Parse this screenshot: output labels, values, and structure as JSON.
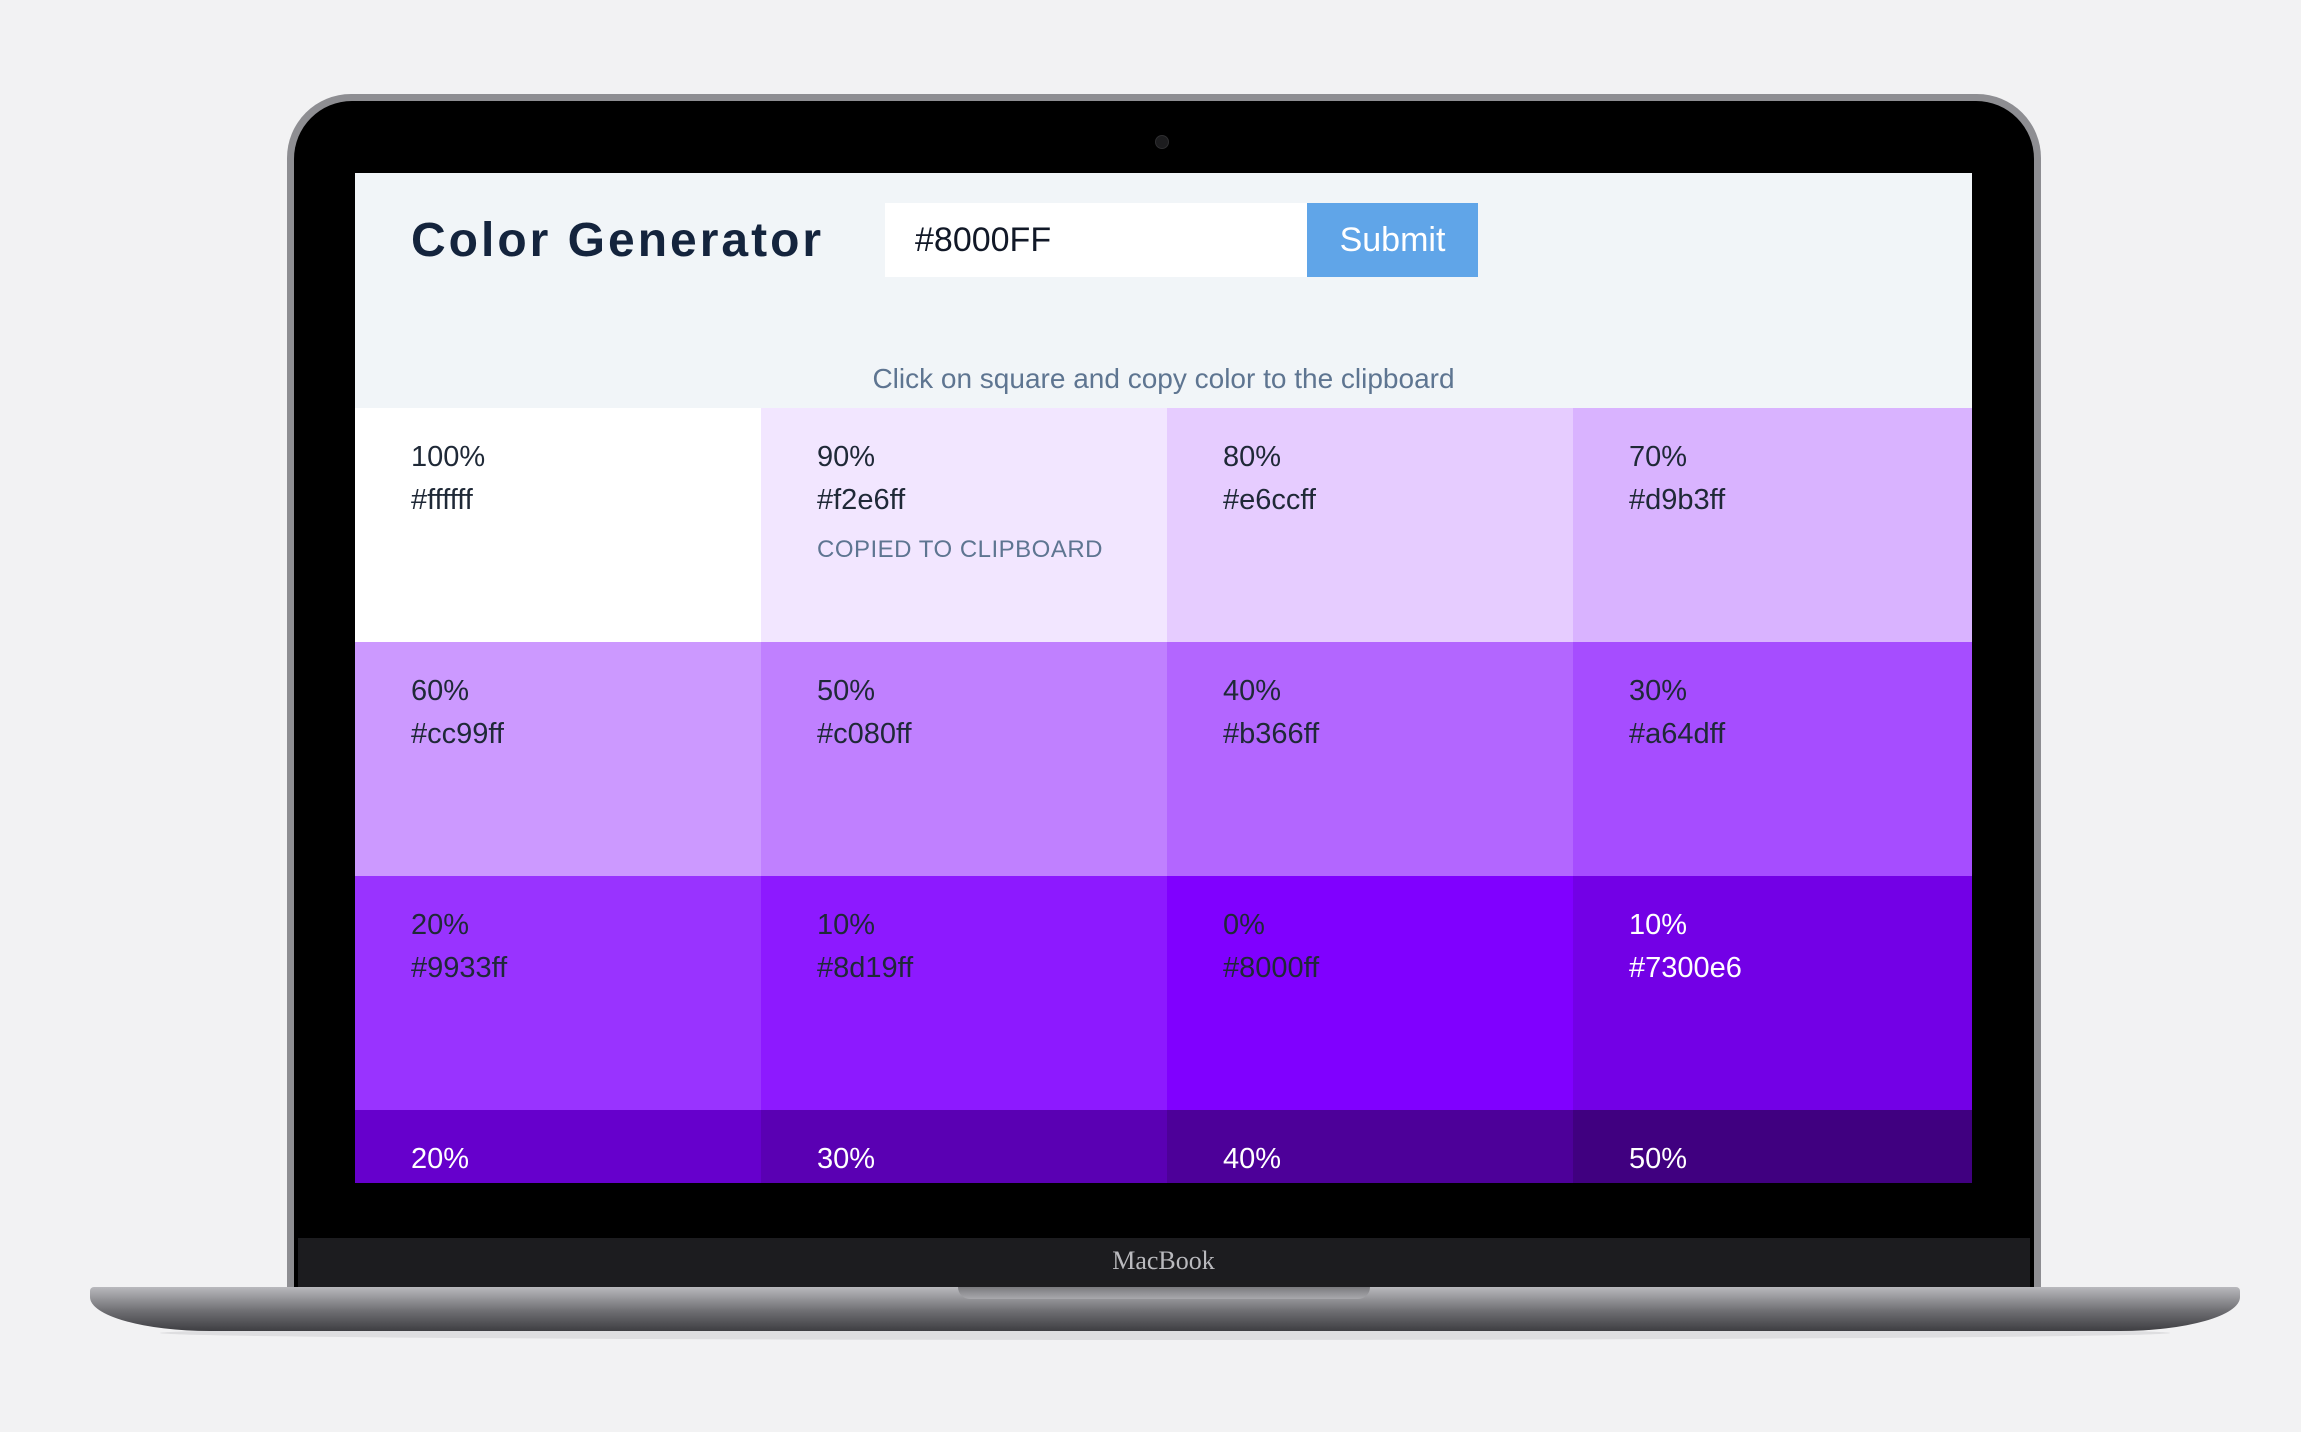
{
  "device": {
    "brand": "MacBook"
  },
  "app": {
    "title": "Color Generator",
    "input_value": "#8000FF",
    "submit_label": "Submit",
    "instructions": "Click on square and copy color to the clipboard",
    "copied_label": "COPIED TO CLIPBOARD"
  },
  "swatches": [
    {
      "percent": "100%",
      "hex": "#ffffff",
      "color": "#ffffff",
      "text": "dark",
      "copied": false
    },
    {
      "percent": "90%",
      "hex": "#f2e6ff",
      "color": "#f2e6ff",
      "text": "dark",
      "copied": true
    },
    {
      "percent": "80%",
      "hex": "#e6ccff",
      "color": "#e6ccff",
      "text": "dark",
      "copied": false
    },
    {
      "percent": "70%",
      "hex": "#d9b3ff",
      "color": "#d9b3ff",
      "text": "dark",
      "copied": false
    },
    {
      "percent": "60%",
      "hex": "#cc99ff",
      "color": "#cc99ff",
      "text": "dark",
      "copied": false
    },
    {
      "percent": "50%",
      "hex": "#c080ff",
      "color": "#c080ff",
      "text": "dark",
      "copied": false
    },
    {
      "percent": "40%",
      "hex": "#b366ff",
      "color": "#b366ff",
      "text": "dark",
      "copied": false
    },
    {
      "percent": "30%",
      "hex": "#a64dff",
      "color": "#a64dff",
      "text": "dark",
      "copied": false
    },
    {
      "percent": "20%",
      "hex": "#9933ff",
      "color": "#9933ff",
      "text": "dark",
      "copied": false
    },
    {
      "percent": "10%",
      "hex": "#8d19ff",
      "color": "#8d19ff",
      "text": "dark",
      "copied": false
    },
    {
      "percent": "0%",
      "hex": "#8000ff",
      "color": "#8000ff",
      "text": "dark",
      "copied": false
    },
    {
      "percent": "10%",
      "hex": "#7300e6",
      "color": "#7300e6",
      "text": "light",
      "copied": false
    },
    {
      "percent": "20%",
      "hex": "",
      "color": "#6600cc",
      "text": "light",
      "copied": false
    },
    {
      "percent": "30%",
      "hex": "",
      "color": "#5a00b3",
      "text": "light",
      "copied": false
    },
    {
      "percent": "40%",
      "hex": "",
      "color": "#4d0099",
      "text": "light",
      "copied": false
    },
    {
      "percent": "50%",
      "hex": "",
      "color": "#400080",
      "text": "light",
      "copied": false
    }
  ]
}
